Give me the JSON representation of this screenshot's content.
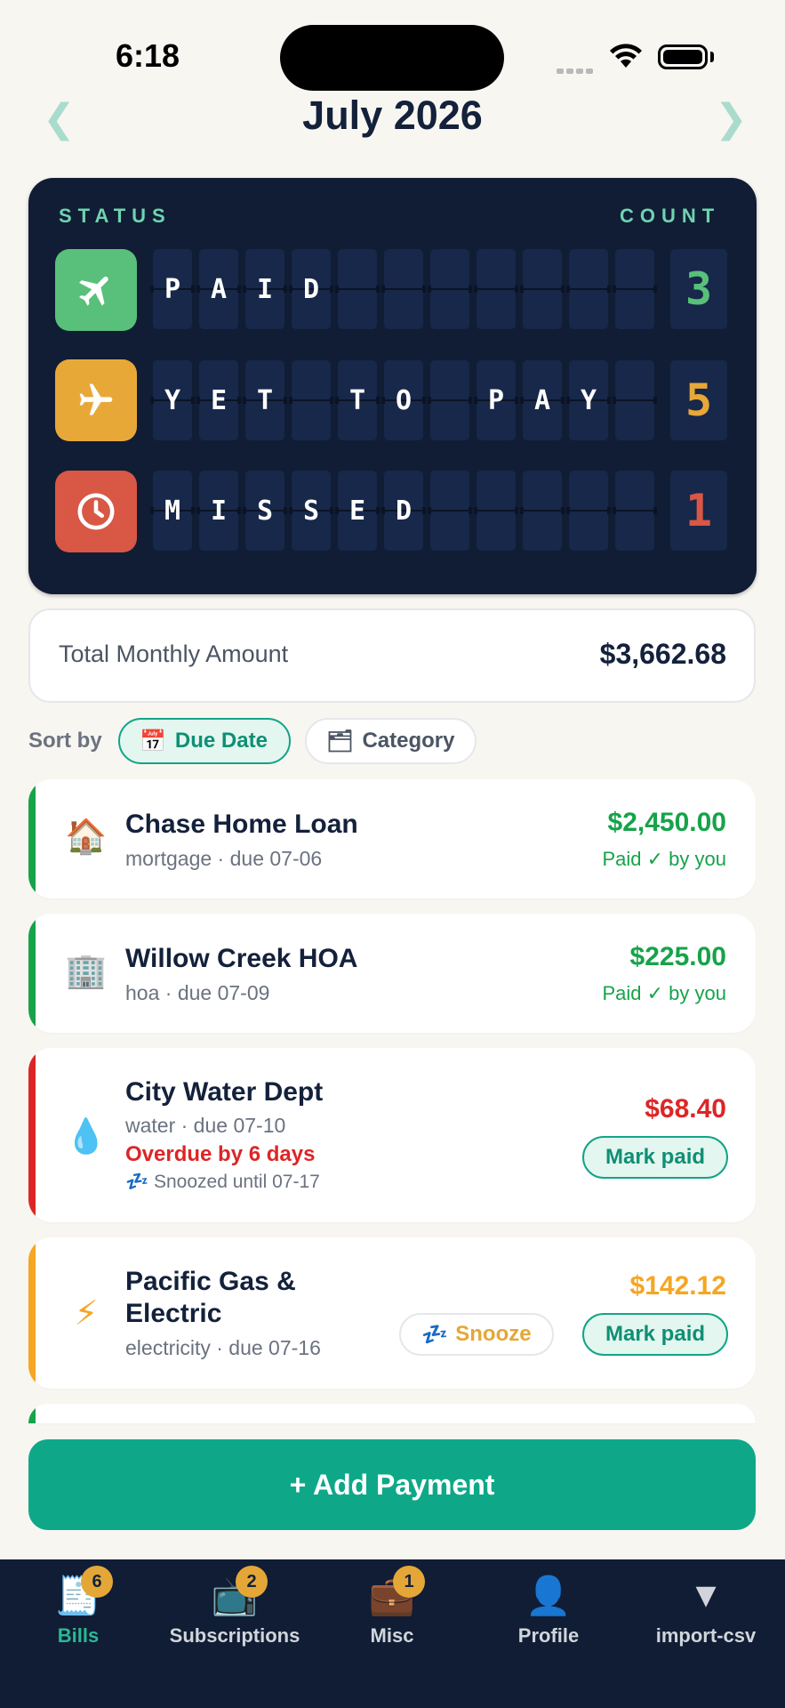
{
  "status_bar": {
    "time": "6:18"
  },
  "header": {
    "month": "July 2026",
    "prev_icon": "chevron-left-icon",
    "next_icon": "chevron-right-icon"
  },
  "board": {
    "status_label": "STATUS",
    "count_label": "COUNT",
    "rows": [
      {
        "label": "PAID",
        "count": "3",
        "icon": "plane-landing-icon",
        "color": "#58c07a",
        "count_color": "#58c07a"
      },
      {
        "label": "YET TO PAY",
        "count": "5",
        "icon": "plane-takeoff-icon",
        "color": "#e8a838",
        "count_color": "#e8a838"
      },
      {
        "label": "MISSED",
        "count": "1",
        "icon": "clock-icon",
        "color": "#d95745",
        "count_color": "#d95745"
      }
    ]
  },
  "total": {
    "label": "Total Monthly Amount",
    "value": "$3,662.68"
  },
  "sort": {
    "label": "Sort by",
    "options": [
      {
        "icon": "📅",
        "label": "Due Date",
        "selected": true
      },
      {
        "icon": "🗂",
        "label": "Category",
        "selected": false
      }
    ]
  },
  "bills": [
    {
      "emoji": "🏠",
      "name": "Chase Home Loan",
      "subtitle": "mortgage · due 07-06",
      "amount": "$2,450.00",
      "status": "Paid ✓ by you",
      "bar_color": "#16a34a"
    },
    {
      "emoji": "🏢",
      "name": "Willow Creek HOA",
      "subtitle": "hoa · due 07-09",
      "amount": "$225.00",
      "status": "Paid ✓ by you",
      "bar_color": "#16a34a"
    },
    {
      "emoji": "💧",
      "name": "City Water Dept",
      "subtitle": "water · due 07-10",
      "amount": "$68.40",
      "overdue": "Overdue by 6 days",
      "snoozed": "Snoozed until 07-17",
      "snooze_icon": "💤",
      "action": "Mark paid",
      "bar_color": "#dc2626"
    },
    {
      "emoji": "⚡",
      "name_line1": "Pacific Gas &",
      "name_line2": "Electric",
      "subtitle": "electricity · due 07-16",
      "amount": "$142.12",
      "snooze_label": "Snooze",
      "snooze_icon": "💤",
      "action": "Mark paid",
      "bar_color": "#f5a623"
    }
  ],
  "add_button": "+ Add Payment",
  "tabs": [
    {
      "icon": "🧾",
      "label": "Bills",
      "badge": "6",
      "active": true
    },
    {
      "icon": "📺",
      "label": "Subscriptions",
      "badge": "2",
      "active": false
    },
    {
      "icon": "💼",
      "label": "Misc",
      "badge": "1",
      "active": false
    },
    {
      "icon": "👤",
      "label": "Profile",
      "active": false
    },
    {
      "icon": "▼",
      "label": "import-csv",
      "active": false
    }
  ]
}
